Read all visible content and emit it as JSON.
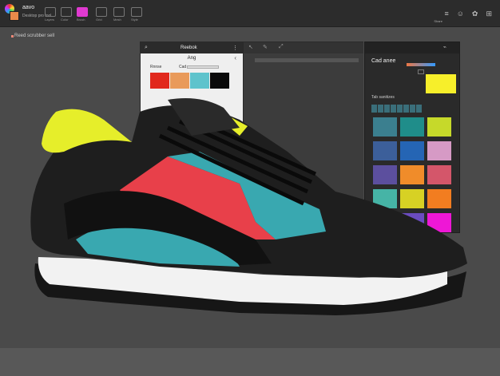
{
  "app": {
    "name": "aavo",
    "subtitle": "Desktop pro tool"
  },
  "toolbar": {
    "tools": [
      {
        "label": "Layers"
      },
      {
        "label": "Color"
      },
      {
        "label": "Brush"
      },
      {
        "label": "Grid"
      },
      {
        "label": "Mesh"
      },
      {
        "label": "Style"
      }
    ],
    "right_label": "Share",
    "right_icons": [
      "≡",
      "☺",
      "✿",
      "⊞"
    ]
  },
  "canvas": {
    "title": "Reed scrubber sell"
  },
  "dialog": {
    "title": "Reebok",
    "subtitle": "Ang",
    "row_left": "Rnnse",
    "row_mid": "Cad",
    "swatches": [
      "#e1281c",
      "#e99a5a",
      "#5ec3cc",
      "#0a0a0a"
    ],
    "swatches2": [
      "#efb0a8",
      "#d9a0a8"
    ]
  },
  "color_panel": {
    "title": "Cad anee",
    "section": "Tab sanitizes",
    "grid_colors": [
      "#3b7f8f",
      "#1f8d8a",
      "#c6d92a",
      "#3c5f9a",
      "#2565b4",
      "#d69ac5",
      "#5c4f9e",
      "#f08c2a",
      "#d4566a",
      "#46b4a6",
      "#d7d124",
      "#f27d20",
      "#3c7da3",
      "#6b4cc0",
      "#ee17d6"
    ]
  },
  "colors": {
    "accent_magenta": "#e03ad0",
    "shoe_upper": "#1e1e1e",
    "shoe_red": "#e8404a",
    "shoe_teal": "#39a8b0",
    "shoe_collar": "#e6ee2a",
    "sole_white": "#f2f2f2"
  }
}
